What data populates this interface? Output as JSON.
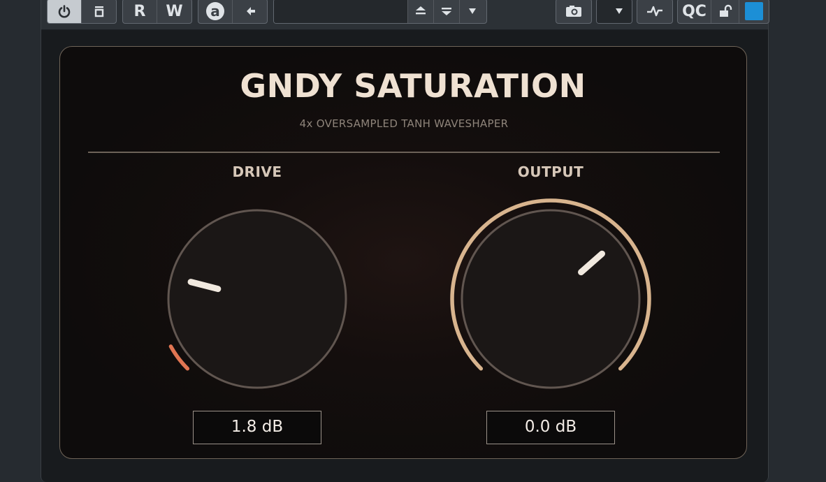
{
  "toolbar": {
    "preset_name": "",
    "buttons": {
      "power": "power-icon",
      "bypass": "bypass-icon",
      "read": "R",
      "write": "W",
      "auto": "a",
      "back": "arrow-left-icon",
      "camera": "camera-icon",
      "activity": "activity-icon",
      "qc": "QC",
      "lock": "unlock-icon"
    },
    "colors": {
      "accent": "#1c8fd6"
    }
  },
  "plugin": {
    "title": "GNDY SATURATION",
    "subtitle": "4x OVERSAMPLED TANH WAVESHAPER",
    "knobs": [
      {
        "id": "drive",
        "label": "DRIVE",
        "display": "1.8 dB",
        "arc_fraction": 0.06,
        "pointer_fraction": 0.22,
        "arc_color": "#e07552"
      },
      {
        "id": "output",
        "label": "OUTPUT",
        "display": "0.0 dB",
        "arc_fraction": 1.0,
        "pointer_fraction": 0.68,
        "arc_color": "#d8b48e"
      }
    ]
  }
}
